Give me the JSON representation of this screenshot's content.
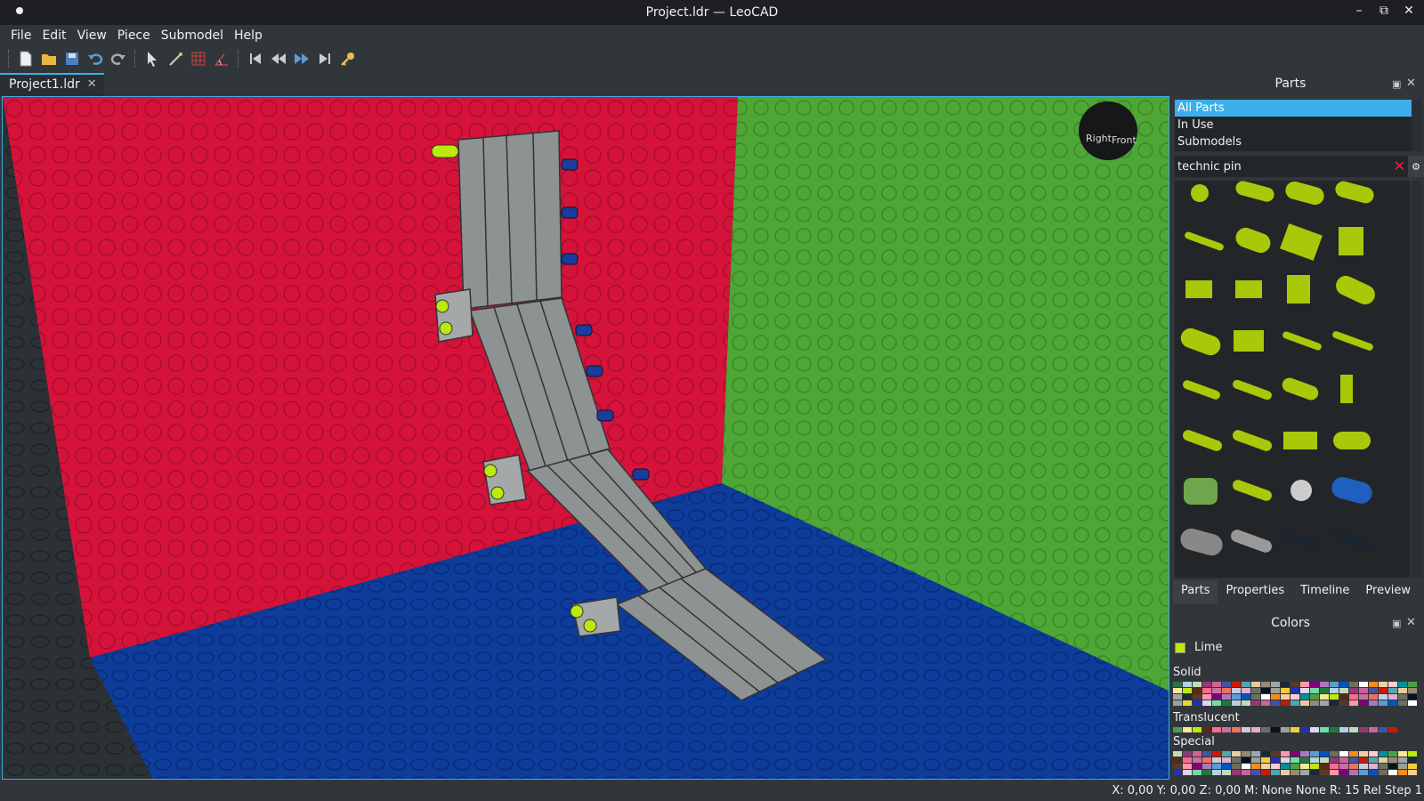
{
  "window": {
    "title": "Project.ldr — LeoCAD",
    "minimize": "–",
    "restore": "⧉",
    "close": "✕"
  },
  "menu": [
    "File",
    "Edit",
    "View",
    "Piece",
    "Submodel",
    "Help"
  ],
  "toolbar_icons": [
    "new-file-icon",
    "open-folder-icon",
    "save-icon",
    "undo-icon",
    "redo-icon",
    "select-icon",
    "magic-wand-icon",
    "snap-grid-icon",
    "angle-snap-icon",
    "first-step-icon",
    "previous-step-icon",
    "next-step-icon",
    "last-step-icon",
    "key-icon"
  ],
  "tab": {
    "label": "Project1.ldr",
    "close": "✕"
  },
  "viewcube": {
    "right": "Right",
    "front": "Front"
  },
  "parts_panel": {
    "title": "Parts",
    "categories": [
      "All Parts",
      "In Use",
      "Submodels"
    ],
    "search_value": "technic pin",
    "bottom_tabs": [
      "Parts",
      "Properties",
      "Timeline",
      "Preview"
    ]
  },
  "colors_panel": {
    "title": "Colors",
    "current_color": "Lime",
    "groups": [
      "Solid",
      "Translucent",
      "Special"
    ]
  },
  "status": {
    "text": "X: 0,00 Y: 0,00 Z: 0,00   M: None None R: 15 Rel   Step 1"
  },
  "theme": {
    "accent": "#3daee9",
    "red_wall": "#d5133a",
    "green_wall": "#4da636",
    "blue_floor": "#0d3c9a",
    "part_gray": "#8b9090",
    "lime": "#bbe90b"
  }
}
